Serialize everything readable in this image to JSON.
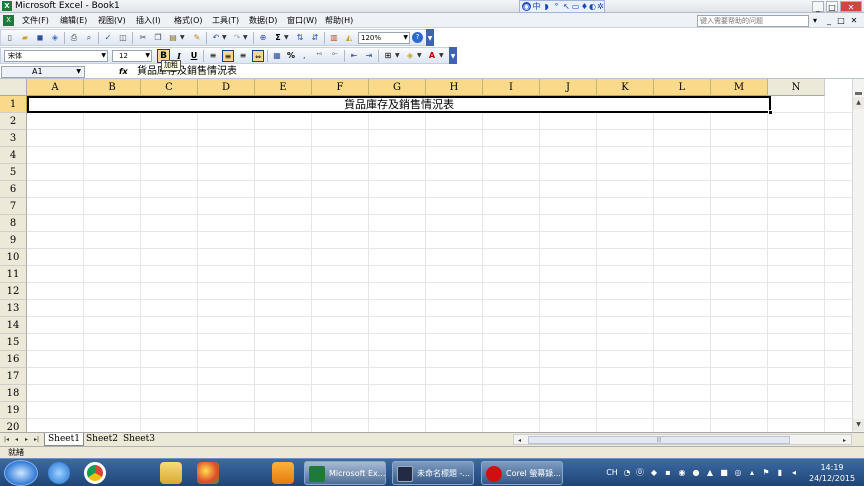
{
  "window": {
    "title": "Microsoft Excel - Book1",
    "app_icon": "excel-icon",
    "controls": [
      "_",
      "□",
      "✕"
    ]
  },
  "ime_bar": {
    "icons": [
      "ime-logo-icon",
      "chinese-mode-icon",
      "half-moon-icon",
      "punctuation-icon",
      "pen-icon",
      "keyboard-icon",
      "microphone-icon",
      "help-icon",
      "settings-icon"
    ],
    "mode": "中"
  },
  "menubar": {
    "items": [
      {
        "label": "文件(F)"
      },
      {
        "label": "编辑(E)"
      },
      {
        "label": "视图(V)"
      },
      {
        "label": "插入(I)"
      },
      {
        "label": "格式(O)"
      },
      {
        "label": "工具(T)"
      },
      {
        "label": "数据(D)"
      },
      {
        "label": "窗口(W)"
      },
      {
        "label": "帮助(H)"
      }
    ],
    "help_placeholder": "键入需要帮助的问题",
    "doc_controls": [
      "▾",
      "_",
      "□",
      "✕"
    ]
  },
  "toolbar_standard": {
    "sigma": "Σ",
    "zoom": "120%"
  },
  "toolbar_format": {
    "font_name": "宋体",
    "font_size": "12",
    "bold": "B",
    "italic": "I",
    "underline": "U",
    "percent": "%",
    "bold_tooltip": "加粗"
  },
  "formula_bar": {
    "cell_ref": "A1",
    "fx": "fx",
    "content": "貨品庫存及銷售情況表"
  },
  "sheet": {
    "columns": [
      "A",
      "B",
      "C",
      "D",
      "E",
      "F",
      "G",
      "H",
      "I",
      "J",
      "K",
      "L",
      "M",
      "N"
    ],
    "selected_columns": [
      "A",
      "B",
      "C",
      "D",
      "E",
      "F",
      "G",
      "H",
      "I",
      "J",
      "K",
      "L",
      "M"
    ],
    "rows": [
      "1",
      "2",
      "3",
      "4",
      "5",
      "6",
      "7",
      "8",
      "9",
      "10",
      "11",
      "12",
      "13",
      "14",
      "15",
      "16",
      "17",
      "18",
      "19",
      "20"
    ],
    "merged_range": "A1:M1",
    "merged_text": "貨品庫存及銷售情況表"
  },
  "sheet_tabs": {
    "nav": [
      "|◂",
      "◂",
      "▸",
      "▸|"
    ],
    "tabs": [
      {
        "label": "Sheet1"
      },
      {
        "label": "Sheet2"
      },
      {
        "label": "Sheet3"
      }
    ],
    "active": "Sheet1"
  },
  "statusbar": {
    "text": "就緒"
  },
  "taskbar": {
    "pinned": [
      "ie-icon",
      "chrome-icon",
      "folder-icon",
      "paint-icon",
      "media-player-icon"
    ],
    "buttons": [
      {
        "label": "Microsoft Ex...",
        "icon": "excel-icon",
        "color": "#1e7a3a"
      },
      {
        "label": "未命名標題 -...",
        "icon": "screen-recorder-icon",
        "color": "#222a44"
      },
      {
        "label": "Corel 螢幕錄...",
        "icon": "record-icon",
        "color": "#d01010"
      }
    ],
    "tray": {
      "lang": "CH"
    },
    "clock": {
      "time": "14:19",
      "date": "24/12/2015"
    }
  },
  "colors": {
    "selection_header": "#f9d98a",
    "taskbar": "#1f4576",
    "grid_line": "#e6e6e6"
  }
}
